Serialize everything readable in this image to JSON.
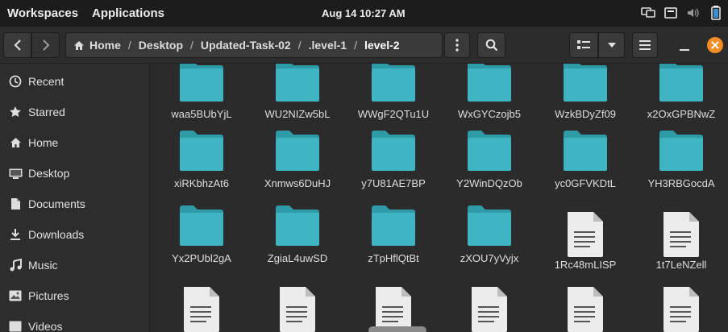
{
  "topbar": {
    "workspaces": "Workspaces",
    "applications": "Applications",
    "clock": "Aug 14  10:27 AM"
  },
  "headerbar": {
    "path": [
      "Home",
      "Desktop",
      "Updated-Task-02",
      ".level-1",
      "level-2"
    ]
  },
  "sidebar": {
    "items": [
      {
        "label": "Recent",
        "icon": "clock-icon"
      },
      {
        "label": "Starred",
        "icon": "star-icon"
      },
      {
        "label": "Home",
        "icon": "home-icon"
      },
      {
        "label": "Desktop",
        "icon": "desktop-icon"
      },
      {
        "label": "Documents",
        "icon": "document-icon"
      },
      {
        "label": "Downloads",
        "icon": "download-icon"
      },
      {
        "label": "Music",
        "icon": "music-icon"
      },
      {
        "label": "Pictures",
        "icon": "picture-icon"
      },
      {
        "label": "Videos",
        "icon": "video-icon"
      }
    ]
  },
  "files": [
    {
      "name": "waa5BUbYjL",
      "type": "folder"
    },
    {
      "name": "WU2NIZw5bL",
      "type": "folder"
    },
    {
      "name": "WWgF2QTu1U",
      "type": "folder"
    },
    {
      "name": "WxGYCzojb5",
      "type": "folder"
    },
    {
      "name": "WzkBDyZf09",
      "type": "folder"
    },
    {
      "name": "x2OxGPBNwZ",
      "type": "folder"
    },
    {
      "name": "xiRKbhzAt6",
      "type": "folder"
    },
    {
      "name": "Xnmws6DuHJ",
      "type": "folder"
    },
    {
      "name": "y7U81AE7BP",
      "type": "folder"
    },
    {
      "name": "Y2WinDQzOb",
      "type": "folder"
    },
    {
      "name": "yc0GFVKDtL",
      "type": "folder"
    },
    {
      "name": "YH3RBGocdA",
      "type": "folder"
    },
    {
      "name": "Yx2PUbl2gA",
      "type": "folder"
    },
    {
      "name": "ZgiaL4uwSD",
      "type": "folder"
    },
    {
      "name": "zTpHflQtBt",
      "type": "folder"
    },
    {
      "name": "zXOU7yVyjx",
      "type": "folder"
    },
    {
      "name": "1Rc48mLISP",
      "type": "file"
    },
    {
      "name": "1t7LeNZell",
      "type": "file"
    },
    {
      "name": "",
      "type": "file"
    },
    {
      "name": "",
      "type": "file"
    },
    {
      "name": "",
      "type": "file"
    },
    {
      "name": "",
      "type": "file"
    },
    {
      "name": "",
      "type": "file"
    },
    {
      "name": "",
      "type": "file"
    }
  ],
  "colors": {
    "folder": "#3fb5c4",
    "folder_tab": "#2f9aa8",
    "close": "#f28e26"
  }
}
